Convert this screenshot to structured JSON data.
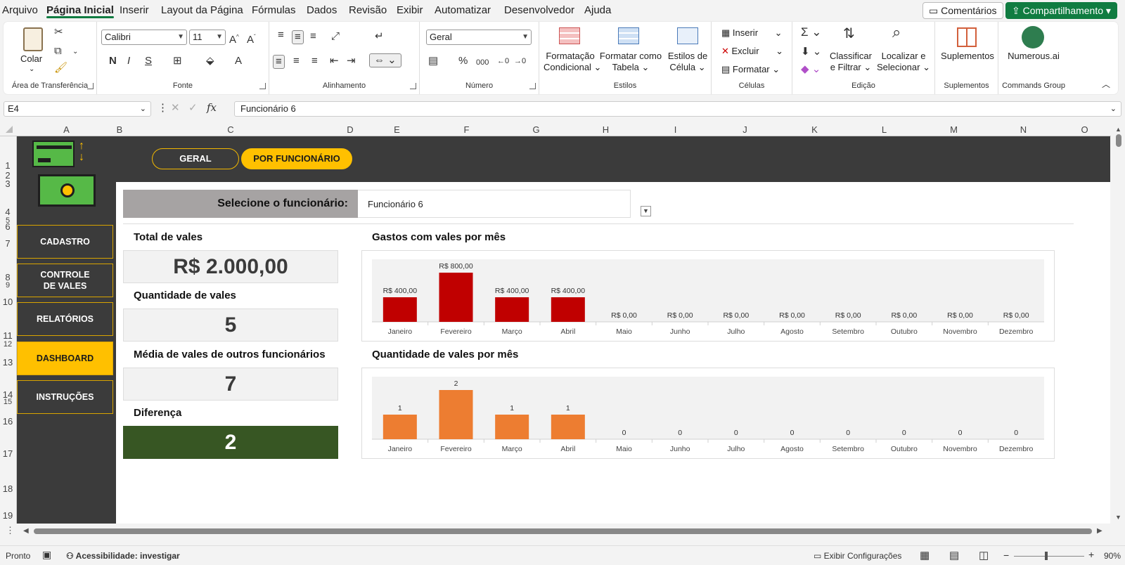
{
  "menu": {
    "items": [
      "Arquivo",
      "Página Inicial",
      "Inserir",
      "Layout da Página",
      "Fórmulas",
      "Dados",
      "Revisão",
      "Exibir",
      "Automatizar",
      "Desenvolvedor",
      "Ajuda"
    ],
    "active": "Página Inicial",
    "comments": "Comentários",
    "share": "Compartilhamento"
  },
  "ribbon": {
    "clipboard": {
      "label": "Área de Transferência",
      "paste": "Colar"
    },
    "font": {
      "label": "Fonte",
      "family": "Calibri",
      "size": "11"
    },
    "alignment": {
      "label": "Alinhamento"
    },
    "number": {
      "label": "Número",
      "format": "Geral"
    },
    "styles": {
      "label": "Estilos",
      "cond1": "Formatação",
      "cond2": "Condicional",
      "table1": "Formatar como",
      "table2": "Tabela",
      "cell1": "Estilos de",
      "cell2": "Célula"
    },
    "cells": {
      "label": "Células",
      "insert": "Inserir",
      "delete": "Excluir",
      "format": "Formatar"
    },
    "editing": {
      "label": "Edição",
      "sort1": "Classificar",
      "sort2": "e Filtrar",
      "find1": "Localizar e",
      "find2": "Selecionar"
    },
    "addins": {
      "label": "Suplementos",
      "button": "Suplementos"
    },
    "commands": {
      "label": "Commands Group",
      "button": "Numerous.ai"
    }
  },
  "formula": {
    "cell_ref": "E4",
    "content": "Funcionário 6"
  },
  "columns": [
    "A",
    "B",
    "C",
    "D",
    "E",
    "F",
    "G",
    "H",
    "I",
    "J",
    "K",
    "L",
    "M",
    "N",
    "O"
  ],
  "rows": [
    "1",
    "2",
    "3",
    "4",
    "5",
    "6",
    "7",
    "8",
    "9",
    "10",
    "11",
    "12",
    "13",
    "14",
    "15",
    "16",
    "17",
    "18",
    "19"
  ],
  "dashboard": {
    "tabs": {
      "general": "GERAL",
      "by_employee": "POR FUNCIONÁRIO"
    },
    "nav": [
      "CADASTRO",
      "CONTROLE DE VALES",
      "RELATÓRIOS",
      "DASHBOARD",
      "INSTRUÇÕES"
    ],
    "nav_active": "DASHBOARD",
    "select_label": "Selecione o funcionário:",
    "select_value": "Funcionário 6",
    "kpis": [
      {
        "title": "Total de vales",
        "value": "R$ 2.000,00"
      },
      {
        "title": "Quantidade de vales",
        "value": "5"
      },
      {
        "title": "Média de vales de outros funcionários",
        "value": "7"
      },
      {
        "title": "Diferença",
        "value": "2"
      }
    ]
  },
  "chart_data": [
    {
      "type": "bar",
      "title": "Gastos com vales por mês",
      "categories": [
        "Janeiro",
        "Fevereiro",
        "Março",
        "Abril",
        "Maio",
        "Junho",
        "Julho",
        "Agosto",
        "Setembro",
        "Outubro",
        "Novembro",
        "Dezembro"
      ],
      "values": [
        400,
        800,
        400,
        400,
        0,
        0,
        0,
        0,
        0,
        0,
        0,
        0
      ],
      "labels": [
        "R$ 400,00",
        "R$ 800,00",
        "R$ 400,00",
        "R$ 400,00",
        "R$ 0,00",
        "R$ 0,00",
        "R$ 0,00",
        "R$ 0,00",
        "R$ 0,00",
        "R$ 0,00",
        "R$ 0,00",
        "R$ 0,00"
      ],
      "color": "#c00000",
      "ylim": [
        0,
        800
      ]
    },
    {
      "type": "bar",
      "title": "Quantidade de vales por mês",
      "categories": [
        "Janeiro",
        "Fevereiro",
        "Março",
        "Abril",
        "Maio",
        "Junho",
        "Julho",
        "Agosto",
        "Setembro",
        "Outubro",
        "Novembro",
        "Dezembro"
      ],
      "values": [
        1,
        2,
        1,
        1,
        0,
        0,
        0,
        0,
        0,
        0,
        0,
        0
      ],
      "labels": [
        "1",
        "2",
        "1",
        "1",
        "0",
        "0",
        "0",
        "0",
        "0",
        "0",
        "0",
        "0"
      ],
      "color": "#ed7d31",
      "ylim": [
        0,
        2
      ]
    }
  ],
  "status": {
    "ready": "Pronto",
    "accessibility": "Acessibilidade: investigar",
    "display": "Exibir Configurações",
    "zoom": "90%"
  },
  "colors": {
    "dark": "#3b3b3b",
    "gold": "#ffc000",
    "green": "#375623",
    "excel_green": "#107c41"
  }
}
